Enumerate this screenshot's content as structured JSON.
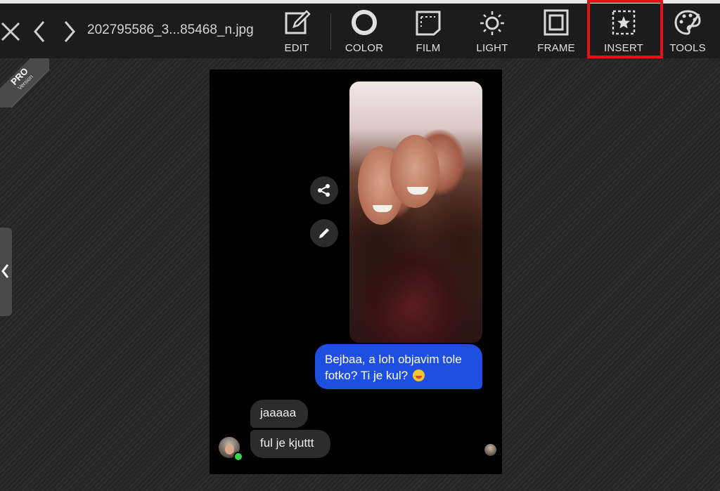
{
  "header": {
    "filename": "202795586_3...85468_n.jpg"
  },
  "tools": [
    {
      "id": "edit",
      "label": "EDIT",
      "icon": "edit-icon"
    },
    {
      "id": "color",
      "label": "COLOR",
      "icon": "color-circle-icon"
    },
    {
      "id": "film",
      "label": "FILM",
      "icon": "film-icon"
    },
    {
      "id": "light",
      "label": "LIGHT",
      "icon": "sun-icon"
    },
    {
      "id": "frame",
      "label": "FRAME",
      "icon": "frame-icon"
    },
    {
      "id": "insert",
      "label": "INSERT",
      "icon": "star-frame-icon",
      "highlighted": true
    },
    {
      "id": "tools",
      "label": "TOOLS",
      "icon": "palette-icon"
    }
  ],
  "badge": {
    "pro": "PRO",
    "version": "Version"
  },
  "chat": {
    "sent_message": "Bejbaa, a loh objavim tole fotko? Ti je kul?",
    "received_messages": [
      "jaaaaa",
      "ful je kjuttt"
    ]
  },
  "colors": {
    "toolbar_bg": "#1c1c1c",
    "highlight": "#e31313",
    "sent_bubble": "#1f4fe0",
    "received_bubble": "#2c2c2c",
    "online": "#3ecf55"
  }
}
